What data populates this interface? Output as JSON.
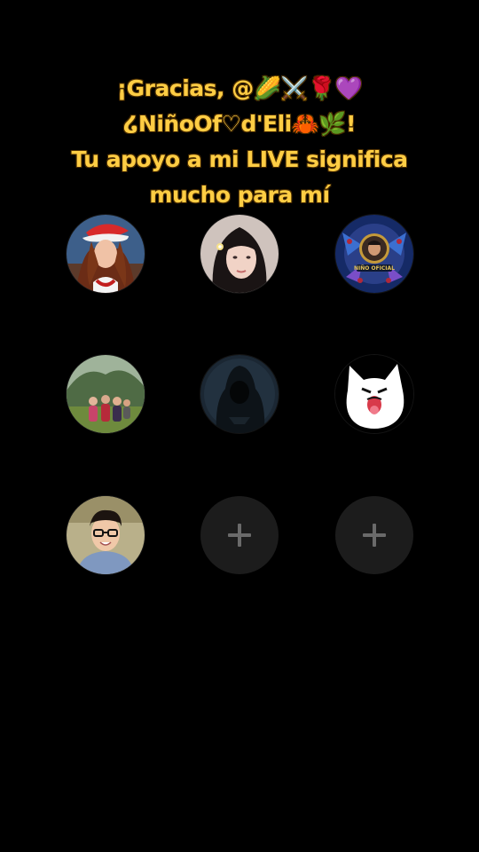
{
  "message": {
    "line1": "¡Gracias, @🌽⚔️🌹💜",
    "line2": "໒NiñoOf♡d'Eli🦀🌿!",
    "line3": "Tu apoyo a mi LIVE significa",
    "line4": "mucho para mí"
  },
  "supporters": [
    {
      "icon": "woman-santa-hat-avatar"
    },
    {
      "icon": "woman-portrait-avatar"
    },
    {
      "icon": "nino-oficial-logo-avatar",
      "badge_text": "NIÑO OFICIAL"
    },
    {
      "icon": "group-photo-avatar"
    },
    {
      "icon": "hooded-figure-avatar"
    },
    {
      "icon": "white-cat-sticker-avatar"
    },
    {
      "icon": "man-glasses-avatar"
    }
  ],
  "empty_slots": [
    {
      "icon": "plus-icon"
    },
    {
      "icon": "plus-icon"
    }
  ],
  "colors": {
    "background": "#000000",
    "headline": "#ffcd44",
    "empty_slot": "#1c1c1c",
    "plus": "#6a6a6a"
  }
}
